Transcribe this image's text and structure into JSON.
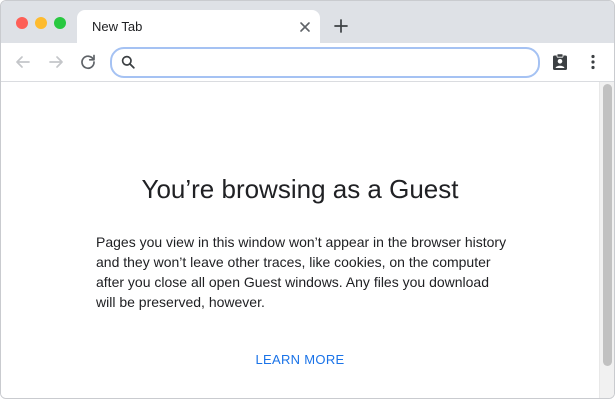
{
  "tab": {
    "title": "New Tab"
  },
  "omnibox": {
    "placeholder": "",
    "value": ""
  },
  "page": {
    "title": "You’re browsing as a Guest",
    "description": "Pages you view in this window won’t appear in the browser history and they won’t leave other traces, like cookies, on the computer after you close all open Guest windows. Any files you download will be preserved, however.",
    "learn_more": "LEARN MORE"
  },
  "icons": {
    "close": "close-icon",
    "new_tab": "plus-icon",
    "back": "arrow-left-icon",
    "forward": "arrow-right-icon",
    "reload": "reload-icon",
    "search": "search-icon",
    "profile": "guest-profile-icon",
    "menu": "more-vert-icon"
  },
  "colors": {
    "accent": "#1a73e8",
    "omnibox_border": "#a5c2f3",
    "tabstrip": "#dee1e6",
    "traffic_red": "#fe5f57",
    "traffic_yellow": "#febb2e",
    "traffic_green": "#28c840"
  }
}
